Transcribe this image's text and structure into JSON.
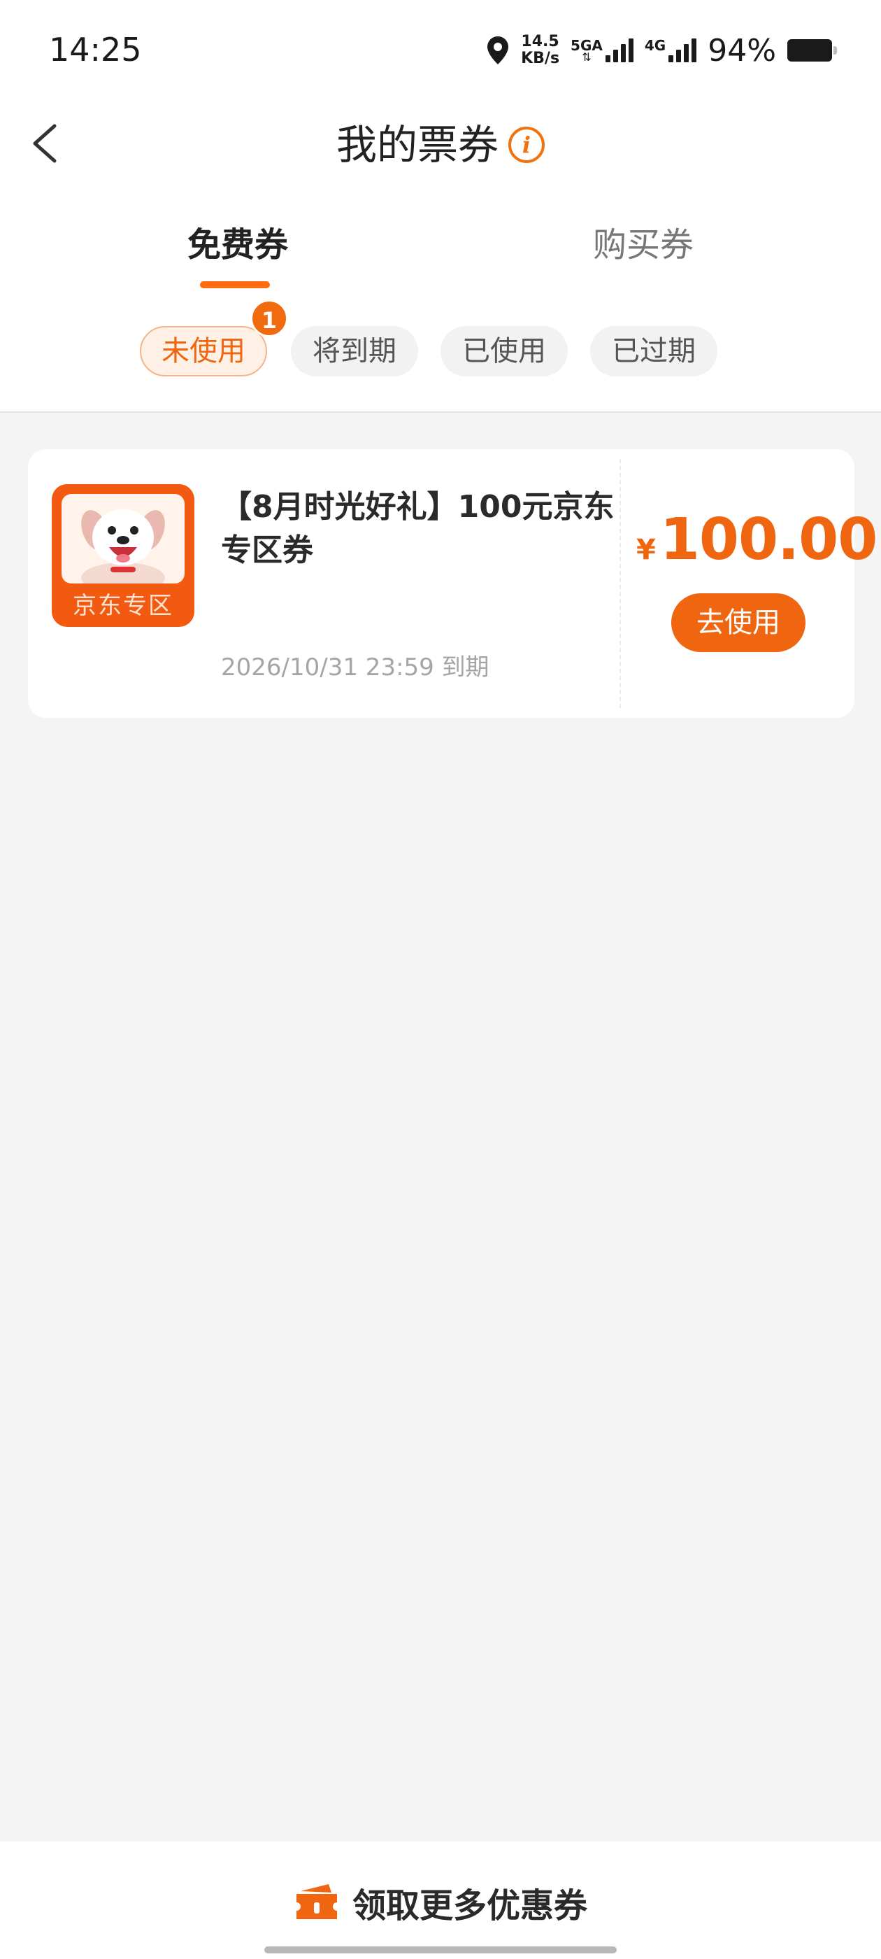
{
  "status_bar": {
    "time": "14:25",
    "net_speed_value": "14.5",
    "net_speed_unit": "KB/s",
    "sim1_label": "5GA",
    "sim2_label": "4G",
    "battery_percent": "94%",
    "icons": [
      "location-icon",
      "signal-icon",
      "battery-icon"
    ]
  },
  "header": {
    "title": "我的票券",
    "info_glyph": "i"
  },
  "tabs": {
    "free": "免费券",
    "purchased": "购买券",
    "active": "free"
  },
  "filters": {
    "unused": "未使用",
    "expiring": "将到期",
    "used": "已使用",
    "expired": "已过期",
    "unused_badge": "1",
    "active": "unused"
  },
  "coupons": [
    {
      "thumb_label": "京东专区",
      "title": "【8月时光好礼】100元京东专区券",
      "expiry": "2026/10/31 23:59 到期",
      "currency": "¥",
      "amount": "100.00",
      "action": "去使用"
    }
  ],
  "footer": {
    "get_more": "领取更多优惠券"
  },
  "colors": {
    "accent": "#f0650f",
    "badge": "#f16a0e",
    "background": "#f4f4f4"
  }
}
